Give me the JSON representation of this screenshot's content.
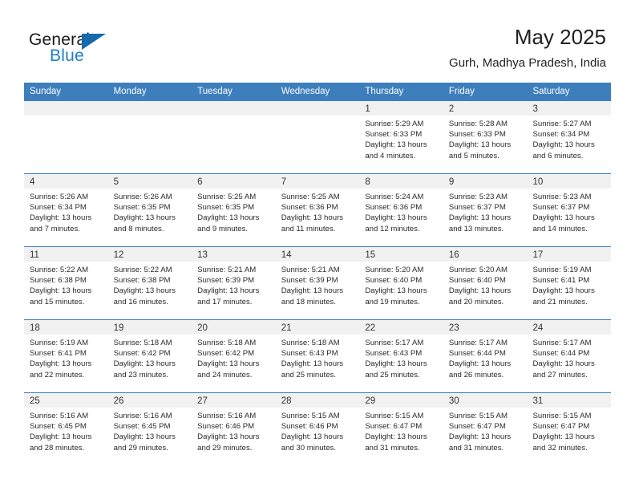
{
  "brand": {
    "name_part1": "General",
    "name_part2": "Blue"
  },
  "header": {
    "month_title": "May 2025",
    "location": "Gurh, Madhya Pradesh, India"
  },
  "colors": {
    "header_blue": "#3d7ebd",
    "brand_blue": "#1f7dc4",
    "daynum_band": "#f1f1f1"
  },
  "weekdays": [
    "Sunday",
    "Monday",
    "Tuesday",
    "Wednesday",
    "Thursday",
    "Friday",
    "Saturday"
  ],
  "weeks": [
    [
      {
        "day": "",
        "sunrise": "",
        "sunset": "",
        "daylight_line1": "",
        "daylight_line2": ""
      },
      {
        "day": "",
        "sunrise": "",
        "sunset": "",
        "daylight_line1": "",
        "daylight_line2": ""
      },
      {
        "day": "",
        "sunrise": "",
        "sunset": "",
        "daylight_line1": "",
        "daylight_line2": ""
      },
      {
        "day": "",
        "sunrise": "",
        "sunset": "",
        "daylight_line1": "",
        "daylight_line2": ""
      },
      {
        "day": "1",
        "sunrise": "Sunrise: 5:29 AM",
        "sunset": "Sunset: 6:33 PM",
        "daylight_line1": "Daylight: 13 hours",
        "daylight_line2": "and 4 minutes."
      },
      {
        "day": "2",
        "sunrise": "Sunrise: 5:28 AM",
        "sunset": "Sunset: 6:33 PM",
        "daylight_line1": "Daylight: 13 hours",
        "daylight_line2": "and 5 minutes."
      },
      {
        "day": "3",
        "sunrise": "Sunrise: 5:27 AM",
        "sunset": "Sunset: 6:34 PM",
        "daylight_line1": "Daylight: 13 hours",
        "daylight_line2": "and 6 minutes."
      }
    ],
    [
      {
        "day": "4",
        "sunrise": "Sunrise: 5:26 AM",
        "sunset": "Sunset: 6:34 PM",
        "daylight_line1": "Daylight: 13 hours",
        "daylight_line2": "and 7 minutes."
      },
      {
        "day": "5",
        "sunrise": "Sunrise: 5:26 AM",
        "sunset": "Sunset: 6:35 PM",
        "daylight_line1": "Daylight: 13 hours",
        "daylight_line2": "and 8 minutes."
      },
      {
        "day": "6",
        "sunrise": "Sunrise: 5:25 AM",
        "sunset": "Sunset: 6:35 PM",
        "daylight_line1": "Daylight: 13 hours",
        "daylight_line2": "and 9 minutes."
      },
      {
        "day": "7",
        "sunrise": "Sunrise: 5:25 AM",
        "sunset": "Sunset: 6:36 PM",
        "daylight_line1": "Daylight: 13 hours",
        "daylight_line2": "and 11 minutes."
      },
      {
        "day": "8",
        "sunrise": "Sunrise: 5:24 AM",
        "sunset": "Sunset: 6:36 PM",
        "daylight_line1": "Daylight: 13 hours",
        "daylight_line2": "and 12 minutes."
      },
      {
        "day": "9",
        "sunrise": "Sunrise: 5:23 AM",
        "sunset": "Sunset: 6:37 PM",
        "daylight_line1": "Daylight: 13 hours",
        "daylight_line2": "and 13 minutes."
      },
      {
        "day": "10",
        "sunrise": "Sunrise: 5:23 AM",
        "sunset": "Sunset: 6:37 PM",
        "daylight_line1": "Daylight: 13 hours",
        "daylight_line2": "and 14 minutes."
      }
    ],
    [
      {
        "day": "11",
        "sunrise": "Sunrise: 5:22 AM",
        "sunset": "Sunset: 6:38 PM",
        "daylight_line1": "Daylight: 13 hours",
        "daylight_line2": "and 15 minutes."
      },
      {
        "day": "12",
        "sunrise": "Sunrise: 5:22 AM",
        "sunset": "Sunset: 6:38 PM",
        "daylight_line1": "Daylight: 13 hours",
        "daylight_line2": "and 16 minutes."
      },
      {
        "day": "13",
        "sunrise": "Sunrise: 5:21 AM",
        "sunset": "Sunset: 6:39 PM",
        "daylight_line1": "Daylight: 13 hours",
        "daylight_line2": "and 17 minutes."
      },
      {
        "day": "14",
        "sunrise": "Sunrise: 5:21 AM",
        "sunset": "Sunset: 6:39 PM",
        "daylight_line1": "Daylight: 13 hours",
        "daylight_line2": "and 18 minutes."
      },
      {
        "day": "15",
        "sunrise": "Sunrise: 5:20 AM",
        "sunset": "Sunset: 6:40 PM",
        "daylight_line1": "Daylight: 13 hours",
        "daylight_line2": "and 19 minutes."
      },
      {
        "day": "16",
        "sunrise": "Sunrise: 5:20 AM",
        "sunset": "Sunset: 6:40 PM",
        "daylight_line1": "Daylight: 13 hours",
        "daylight_line2": "and 20 minutes."
      },
      {
        "day": "17",
        "sunrise": "Sunrise: 5:19 AM",
        "sunset": "Sunset: 6:41 PM",
        "daylight_line1": "Daylight: 13 hours",
        "daylight_line2": "and 21 minutes."
      }
    ],
    [
      {
        "day": "18",
        "sunrise": "Sunrise: 5:19 AM",
        "sunset": "Sunset: 6:41 PM",
        "daylight_line1": "Daylight: 13 hours",
        "daylight_line2": "and 22 minutes."
      },
      {
        "day": "19",
        "sunrise": "Sunrise: 5:18 AM",
        "sunset": "Sunset: 6:42 PM",
        "daylight_line1": "Daylight: 13 hours",
        "daylight_line2": "and 23 minutes."
      },
      {
        "day": "20",
        "sunrise": "Sunrise: 5:18 AM",
        "sunset": "Sunset: 6:42 PM",
        "daylight_line1": "Daylight: 13 hours",
        "daylight_line2": "and 24 minutes."
      },
      {
        "day": "21",
        "sunrise": "Sunrise: 5:18 AM",
        "sunset": "Sunset: 6:43 PM",
        "daylight_line1": "Daylight: 13 hours",
        "daylight_line2": "and 25 minutes."
      },
      {
        "day": "22",
        "sunrise": "Sunrise: 5:17 AM",
        "sunset": "Sunset: 6:43 PM",
        "daylight_line1": "Daylight: 13 hours",
        "daylight_line2": "and 25 minutes."
      },
      {
        "day": "23",
        "sunrise": "Sunrise: 5:17 AM",
        "sunset": "Sunset: 6:44 PM",
        "daylight_line1": "Daylight: 13 hours",
        "daylight_line2": "and 26 minutes."
      },
      {
        "day": "24",
        "sunrise": "Sunrise: 5:17 AM",
        "sunset": "Sunset: 6:44 PM",
        "daylight_line1": "Daylight: 13 hours",
        "daylight_line2": "and 27 minutes."
      }
    ],
    [
      {
        "day": "25",
        "sunrise": "Sunrise: 5:16 AM",
        "sunset": "Sunset: 6:45 PM",
        "daylight_line1": "Daylight: 13 hours",
        "daylight_line2": "and 28 minutes."
      },
      {
        "day": "26",
        "sunrise": "Sunrise: 5:16 AM",
        "sunset": "Sunset: 6:45 PM",
        "daylight_line1": "Daylight: 13 hours",
        "daylight_line2": "and 29 minutes."
      },
      {
        "day": "27",
        "sunrise": "Sunrise: 5:16 AM",
        "sunset": "Sunset: 6:46 PM",
        "daylight_line1": "Daylight: 13 hours",
        "daylight_line2": "and 29 minutes."
      },
      {
        "day": "28",
        "sunrise": "Sunrise: 5:15 AM",
        "sunset": "Sunset: 6:46 PM",
        "daylight_line1": "Daylight: 13 hours",
        "daylight_line2": "and 30 minutes."
      },
      {
        "day": "29",
        "sunrise": "Sunrise: 5:15 AM",
        "sunset": "Sunset: 6:47 PM",
        "daylight_line1": "Daylight: 13 hours",
        "daylight_line2": "and 31 minutes."
      },
      {
        "day": "30",
        "sunrise": "Sunrise: 5:15 AM",
        "sunset": "Sunset: 6:47 PM",
        "daylight_line1": "Daylight: 13 hours",
        "daylight_line2": "and 31 minutes."
      },
      {
        "day": "31",
        "sunrise": "Sunrise: 5:15 AM",
        "sunset": "Sunset: 6:47 PM",
        "daylight_line1": "Daylight: 13 hours",
        "daylight_line2": "and 32 minutes."
      }
    ]
  ]
}
